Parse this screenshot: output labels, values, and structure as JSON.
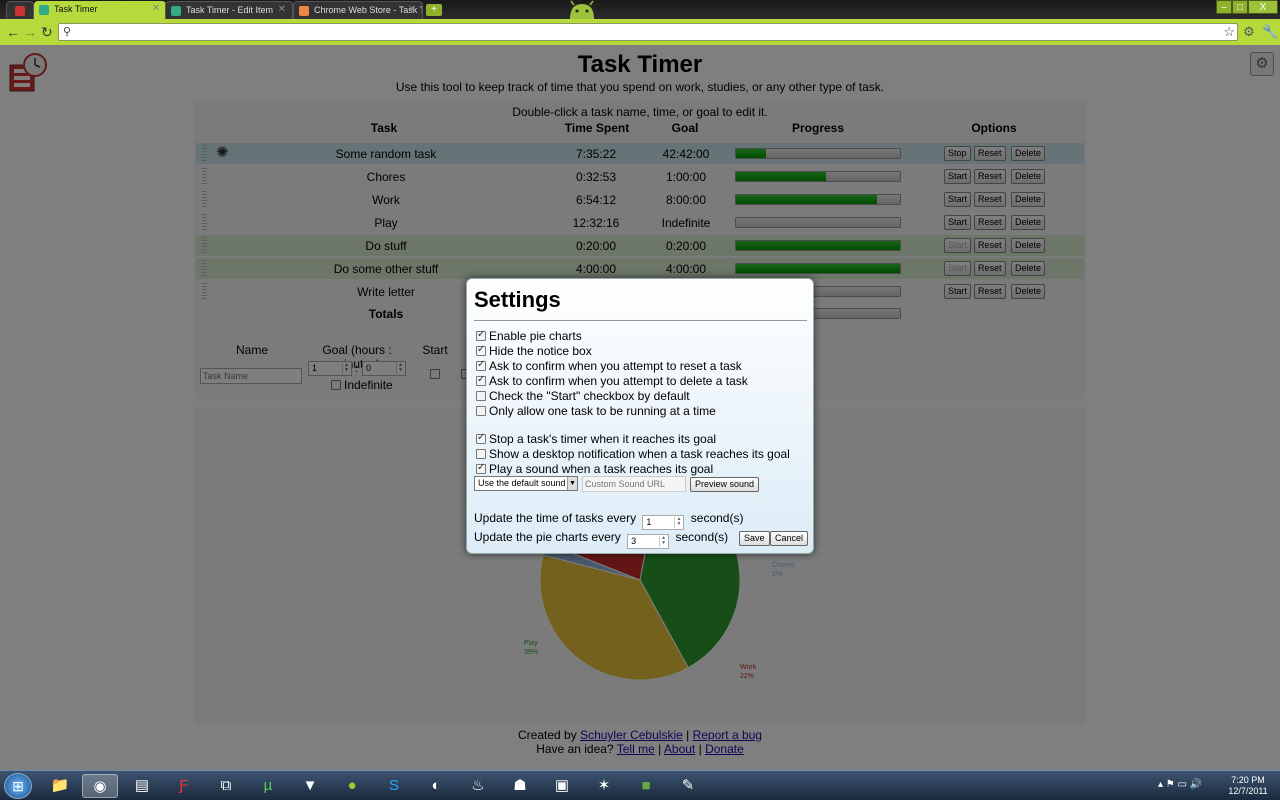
{
  "browser": {
    "tabs": [
      {
        "title": "Task Timer",
        "active": true,
        "icon": "task-timer-favicon"
      },
      {
        "title": "Task Timer - Edit Item",
        "active": false,
        "icon": "task-timer-favicon"
      },
      {
        "title": "Chrome Web Store - Task T",
        "active": false,
        "icon": "chrome-store-favicon"
      }
    ],
    "window_buttons": [
      "–",
      "□",
      "X"
    ]
  },
  "app": {
    "title": "Task Timer",
    "subtitle": "Use this tool to keep track of time that you spend on work, studies, or any other type of task.",
    "hint": "Double-click a task name, time, or goal to edit it.",
    "headers": {
      "task": "Task",
      "time_spent": "Time Spent",
      "goal": "Goal",
      "progress": "Progress",
      "options": "Options"
    },
    "tasks": [
      {
        "name": "Some random task",
        "spent": "7:35:22",
        "goal": "42:42:00",
        "progress": 0.18,
        "state": "running",
        "start_label": "Stop",
        "reset_label": "Reset",
        "delete_label": "Delete"
      },
      {
        "name": "Chores",
        "spent": "0:32:53",
        "goal": "1:00:00",
        "progress": 0.55,
        "state": "idle",
        "start_label": "Start",
        "reset_label": "Reset",
        "delete_label": "Delete"
      },
      {
        "name": "Work",
        "spent": "6:54:12",
        "goal": "8:00:00",
        "progress": 0.86,
        "state": "idle",
        "start_label": "Start",
        "reset_label": "Reset",
        "delete_label": "Delete"
      },
      {
        "name": "Play",
        "spent": "12:32:16",
        "goal": "Indefinite",
        "progress": 0,
        "state": "idle",
        "start_label": "Start",
        "reset_label": "Reset",
        "delete_label": "Delete"
      },
      {
        "name": "Do stuff",
        "spent": "0:20:00",
        "goal": "0:20:00",
        "progress": 1,
        "state": "done",
        "start_label": "Start",
        "reset_label": "Reset",
        "delete_label": "Delete"
      },
      {
        "name": "Do some other stuff",
        "spent": "4:00:00",
        "goal": "4:00:00",
        "progress": 1,
        "state": "done",
        "start_label": "Start",
        "reset_label": "Reset",
        "delete_label": "Delete"
      },
      {
        "name": "Write letter",
        "spent": "",
        "goal": "",
        "progress": 0,
        "state": "idle",
        "start_label": "Start",
        "reset_label": "Reset",
        "delete_label": "Delete"
      }
    ],
    "totals_label": "Totals",
    "add_form": {
      "name_label": "Name",
      "goal_label": "Goal (hours : minutes)",
      "start_label": "Start",
      "name_placeholder": "Task Name",
      "hours": "1",
      "minutes": "0",
      "separator": ":",
      "indefinite_label": "Indefinite"
    },
    "footer": {
      "created_by": "Created by",
      "author": "Schuyler Cebulskie",
      "sep": "|",
      "report": "Report a bug",
      "idea": "Have an idea?",
      "tell": "Tell me",
      "about": "About",
      "donate": "Donate"
    }
  },
  "chart_data": {
    "type": "pie",
    "slices": [
      {
        "label": "Play",
        "value": 39,
        "color": "#2e9a2e"
      },
      {
        "label": "Work",
        "value": 22,
        "color": "#c62b2b"
      },
      {
        "label": "Chores",
        "value": 2,
        "color": "#8fb3d9"
      },
      {
        "label": "",
        "value": 37,
        "color": "#e8c23a"
      }
    ],
    "labels": [
      {
        "name": "Play",
        "pct": "39%"
      },
      {
        "name": "Work",
        "pct": "22%"
      },
      {
        "name": "Chores",
        "pct": "2%"
      }
    ]
  },
  "settings": {
    "title": "Settings",
    "options": [
      {
        "label": "Enable pie charts",
        "checked": true
      },
      {
        "label": "Hide the notice box",
        "checked": true
      },
      {
        "label": "Ask to confirm when you attempt to reset a task",
        "checked": true
      },
      {
        "label": "Ask to confirm when you attempt to delete a task",
        "checked": true
      },
      {
        "label": "Check the \"Start\" checkbox by default",
        "checked": false
      },
      {
        "label": "Only allow one task to be running at a time",
        "checked": false
      }
    ],
    "goal_options": [
      {
        "label": "Stop a task's timer when it reaches its goal",
        "checked": true
      },
      {
        "label": "Show a desktop notification when a task reaches its goal",
        "checked": false
      },
      {
        "label": "Play a sound when a task reaches its goal",
        "checked": true
      }
    ],
    "sound_select": "Use the default sound",
    "sound_url_placeholder": "Custom Sound URL",
    "preview_label": "Preview sound",
    "update_tasks_prefix": "Update the time of tasks every",
    "update_tasks_value": "1",
    "update_tasks_suffix": "second(s)",
    "update_pie_prefix": "Update the pie charts every",
    "update_pie_value": "3",
    "update_pie_suffix": "second(s)",
    "save_label": "Save",
    "cancel_label": "Cancel"
  },
  "taskbar": {
    "time": "7:20 PM",
    "date": "12/7/2011"
  }
}
